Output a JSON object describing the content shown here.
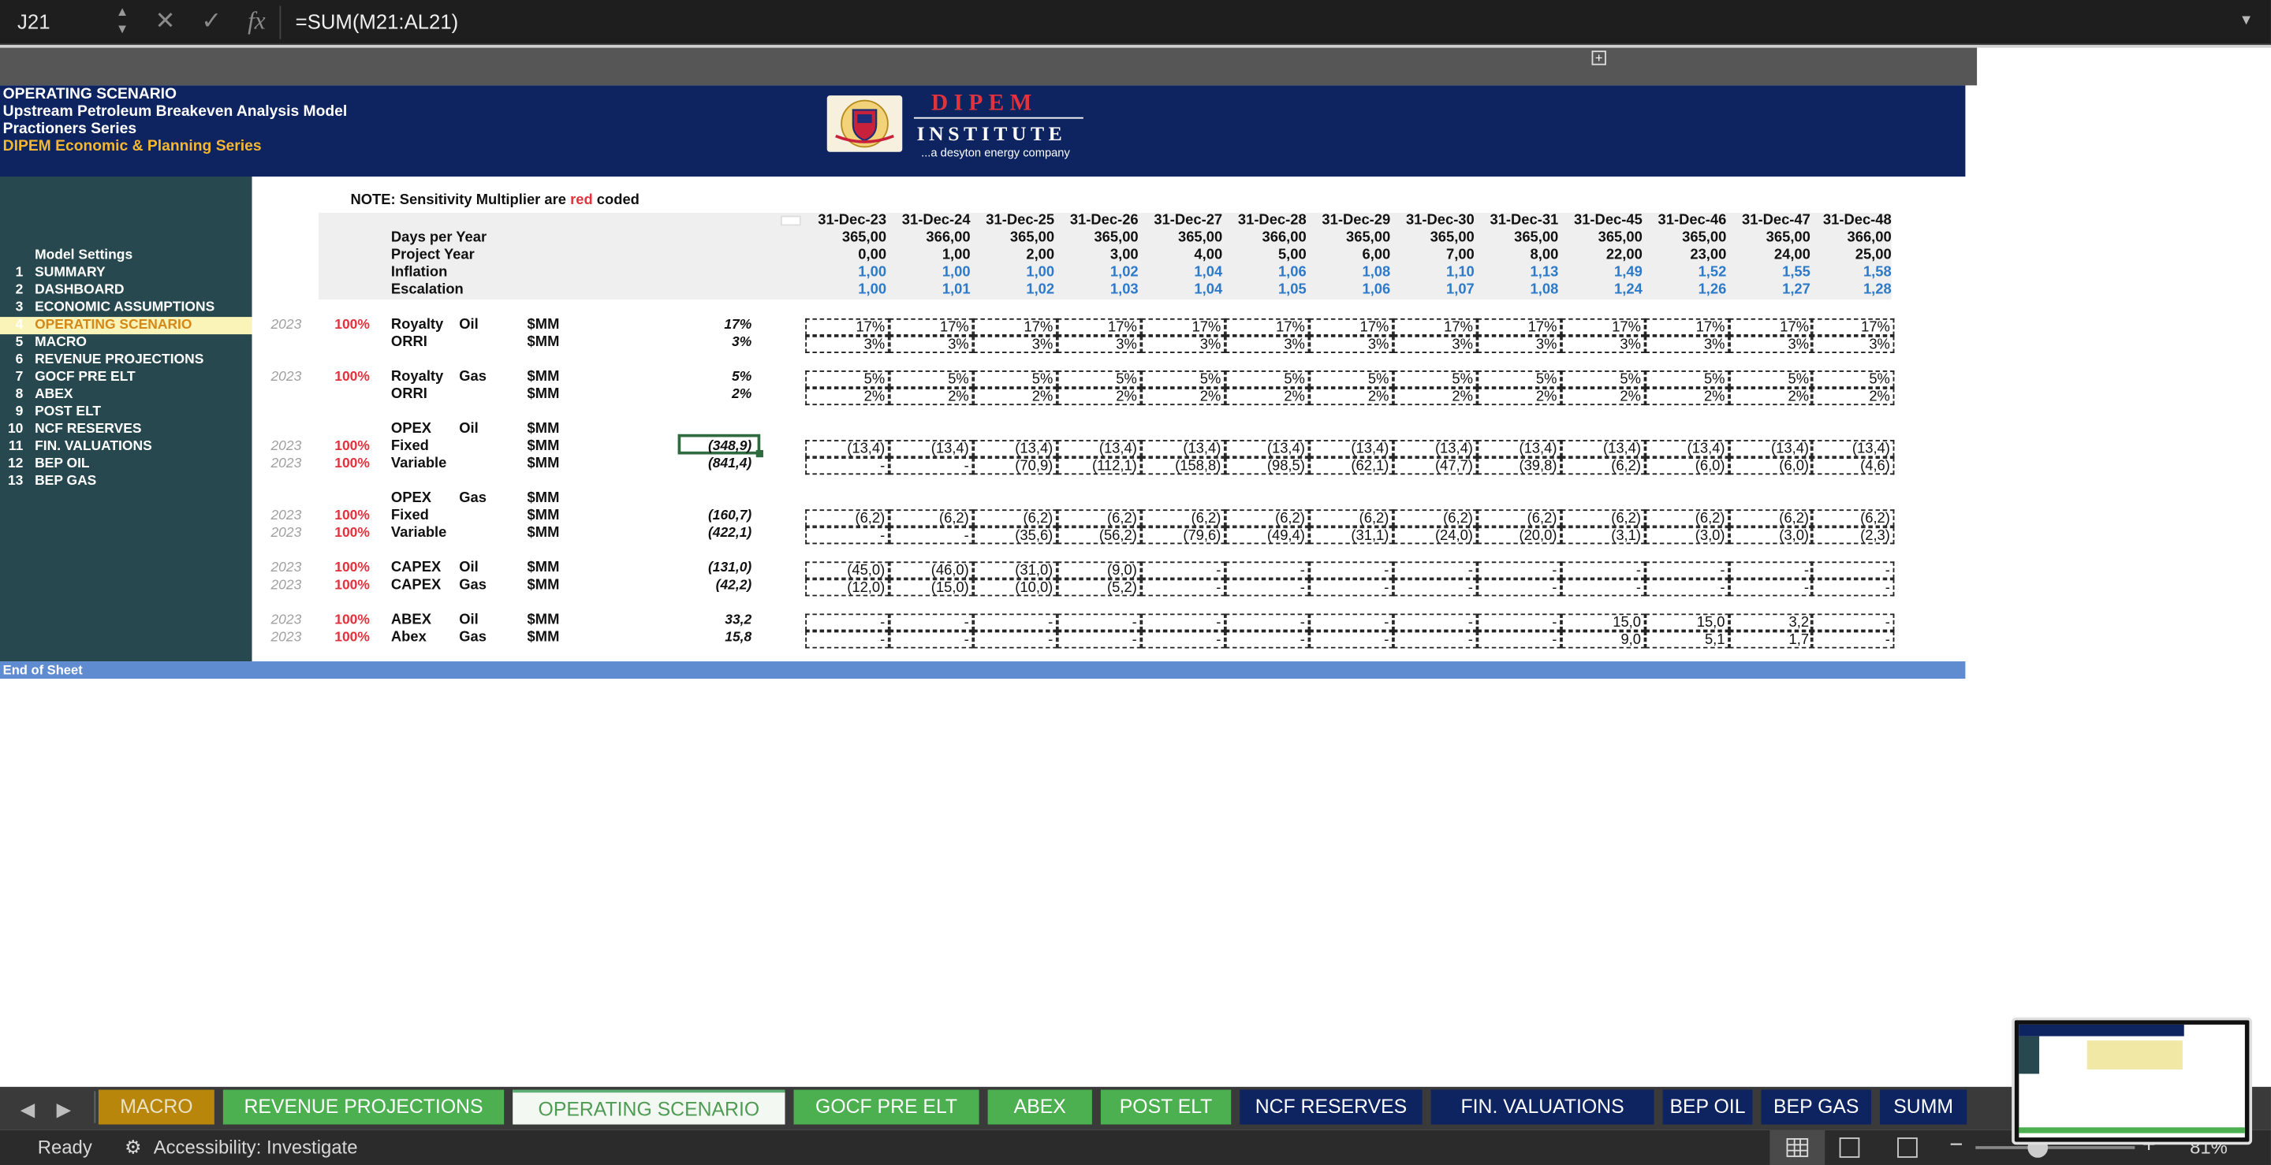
{
  "formula_bar": {
    "name_box": "J21",
    "fx": "fx",
    "formula": "=SUM(M21:AL21)"
  },
  "header": {
    "lines": [
      "OPERATING SCENARIO",
      "Upstream Petroleum Breakeven Analysis Model",
      "Practioners Series",
      "DIPEM Economic & Planning Series"
    ],
    "line_colors": [
      "#ffffff",
      "#ffffff",
      "#ffffff",
      "#f5b731"
    ],
    "brand_name": "DIPEM",
    "brand_sub": "INSTITUTE",
    "brand_tagline": "...a desyton energy company"
  },
  "sidebar": {
    "title": "Model  Settings",
    "items": [
      {
        "num": "1",
        "label": "SUMMARY"
      },
      {
        "num": "2",
        "label": "DASHBOARD"
      },
      {
        "num": "3",
        "label": "ECONOMIC ASSUMPTIONS"
      },
      {
        "num": "4",
        "label": "OPERATING SCENARIO"
      },
      {
        "num": "5",
        "label": "MACRO"
      },
      {
        "num": "6",
        "label": "REVENUE PROJECTIONS"
      },
      {
        "num": "7",
        "label": "GOCF  PRE ELT"
      },
      {
        "num": "8",
        "label": "ABEX"
      },
      {
        "num": "9",
        "label": "POST ELT"
      },
      {
        "num": "10",
        "label": "NCF RESERVES"
      },
      {
        "num": "11",
        "label": "FIN. VALUATIONS"
      },
      {
        "num": "12",
        "label": "BEP OIL"
      },
      {
        "num": "13",
        "label": "BEP GAS"
      }
    ],
    "active_index": 3
  },
  "note": {
    "prefix": "NOTE: Sensitivity Multiplier are ",
    "red_word": "red",
    "suffix": " coded"
  },
  "dates": [
    "31-Dec-23",
    "31-Dec-24",
    "31-Dec-25",
    "31-Dec-26",
    "31-Dec-27",
    "31-Dec-28",
    "31-Dec-29",
    "31-Dec-30",
    "31-Dec-31",
    "31-Dec-45",
    "31-Dec-46",
    "31-Dec-47",
    "31-Dec-48"
  ],
  "header_rows": [
    {
      "label": "Days per Year",
      "blue": false,
      "values": [
        "365,00",
        "366,00",
        "365,00",
        "365,00",
        "365,00",
        "366,00",
        "365,00",
        "365,00",
        "365,00",
        "365,00",
        "365,00",
        "365,00",
        "366,00"
      ]
    },
    {
      "label": "Project Year",
      "blue": false,
      "values": [
        "0,00",
        "1,00",
        "2,00",
        "3,00",
        "4,00",
        "5,00",
        "6,00",
        "7,00",
        "8,00",
        "22,00",
        "23,00",
        "24,00",
        "25,00"
      ]
    },
    {
      "label": "Inflation",
      "blue": true,
      "values": [
        "1,00",
        "1,00",
        "1,00",
        "1,02",
        "1,04",
        "1,06",
        "1,08",
        "1,10",
        "1,13",
        "1,49",
        "1,52",
        "1,55",
        "1,58"
      ]
    },
    {
      "label": "Escalation",
      "blue": true,
      "values": [
        "1,00",
        "1,01",
        "1,02",
        "1,03",
        "1,04",
        "1,05",
        "1,06",
        "1,07",
        "1,08",
        "1,24",
        "1,26",
        "1,27",
        "1,28"
      ]
    }
  ],
  "rows": [
    {
      "year": "2023",
      "pct": "100%",
      "c1": "Royalty",
      "c2": "Oil",
      "unit": "$MM",
      "mult": "17%",
      "values": [
        "17%",
        "17%",
        "17%",
        "17%",
        "17%",
        "17%",
        "17%",
        "17%",
        "17%",
        "17%",
        "17%",
        "17%",
        "17%"
      ]
    },
    {
      "year": "",
      "pct": "",
      "c1": "ORRI",
      "c2": "",
      "unit": "$MM",
      "mult": "3%",
      "values": [
        "3%",
        "3%",
        "3%",
        "3%",
        "3%",
        "3%",
        "3%",
        "3%",
        "3%",
        "3%",
        "3%",
        "3%",
        "3%"
      ]
    },
    {
      "year": "2023",
      "pct": "100%",
      "c1": "Royalty",
      "c2": "Gas",
      "unit": "$MM",
      "mult": "5%",
      "values": [
        "5%",
        "5%",
        "5%",
        "5%",
        "5%",
        "5%",
        "5%",
        "5%",
        "5%",
        "5%",
        "5%",
        "5%",
        "5%"
      ]
    },
    {
      "year": "",
      "pct": "",
      "c1": "ORRI",
      "c2": "",
      "unit": "$MM",
      "mult": "2%",
      "values": [
        "2%",
        "2%",
        "2%",
        "2%",
        "2%",
        "2%",
        "2%",
        "2%",
        "2%",
        "2%",
        "2%",
        "2%",
        "2%"
      ]
    },
    {
      "year": "",
      "pct": "",
      "c1": "OPEX",
      "c2": "Oil",
      "unit": "$MM",
      "mult": "",
      "values": null
    },
    {
      "year": "2023",
      "pct": "100%",
      "c1": "Fixed",
      "c2": "",
      "unit": "$MM",
      "mult": "(348,9)",
      "values": [
        "(13,4)",
        "(13,4)",
        "(13,4)",
        "(13,4)",
        "(13,4)",
        "(13,4)",
        "(13,4)",
        "(13,4)",
        "(13,4)",
        "(13,4)",
        "(13,4)",
        "(13,4)",
        "(13,4)"
      ]
    },
    {
      "year": "2023",
      "pct": "100%",
      "c1": "Variable",
      "c2": "",
      "unit": "$MM",
      "mult": "(841,4)",
      "values": [
        "-",
        "-",
        "(70,9)",
        "(112,1)",
        "(158,8)",
        "(98,5)",
        "(62,1)",
        "(47,7)",
        "(39,8)",
        "(6,2)",
        "(6,0)",
        "(6,0)",
        "(4,6)"
      ]
    },
    {
      "year": "",
      "pct": "",
      "c1": "OPEX",
      "c2": "Gas",
      "unit": "$MM",
      "mult": "",
      "values": null
    },
    {
      "year": "2023",
      "pct": "100%",
      "c1": "Fixed",
      "c2": "",
      "unit": "$MM",
      "mult": "(160,7)",
      "values": [
        "(6,2)",
        "(6,2)",
        "(6,2)",
        "(6,2)",
        "(6,2)",
        "(6,2)",
        "(6,2)",
        "(6,2)",
        "(6,2)",
        "(6,2)",
        "(6,2)",
        "(6,2)",
        "(6,2)"
      ]
    },
    {
      "year": "2023",
      "pct": "100%",
      "c1": "Variable",
      "c2": "",
      "unit": "$MM",
      "mult": "(422,1)",
      "values": [
        "-",
        "-",
        "(35,6)",
        "(56,2)",
        "(79,6)",
        "(49,4)",
        "(31,1)",
        "(24,0)",
        "(20,0)",
        "(3,1)",
        "(3,0)",
        "(3,0)",
        "(2,3)"
      ]
    },
    {
      "year": "2023",
      "pct": "100%",
      "c1": "CAPEX",
      "c2": "Oil",
      "unit": "$MM",
      "mult": "(131,0)",
      "values": [
        "(45,0)",
        "(46,0)",
        "(31,0)",
        "(9,0)",
        "-",
        "-",
        "-",
        "-",
        "-",
        "-",
        "-",
        "-",
        "-"
      ]
    },
    {
      "year": "2023",
      "pct": "100%",
      "c1": "CAPEX",
      "c2": "Gas",
      "unit": "$MM",
      "mult": "(42,2)",
      "values": [
        "(12,0)",
        "(15,0)",
        "(10,0)",
        "(5,2)",
        "-",
        "-",
        "-",
        "-",
        "-",
        "-",
        "-",
        "-",
        "-"
      ]
    },
    {
      "year": "2023",
      "pct": "100%",
      "c1": "ABEX",
      "c2": "Oil",
      "unit": "$MM",
      "mult": "33,2",
      "values": [
        "-",
        "-",
        "-",
        "-",
        "-",
        "-",
        "-",
        "-",
        "-",
        "15,0",
        "15,0",
        "3,2",
        "-"
      ]
    },
    {
      "year": "2023",
      "pct": "100%",
      "c1": "Abex",
      "c2": "Gas",
      "unit": "$MM",
      "mult": "15,8",
      "values": [
        "-",
        "-",
        "-",
        "-",
        "-",
        "-",
        "-",
        "-",
        "-",
        "9,0",
        "5,1",
        "1,7",
        "-"
      ]
    }
  ],
  "end_of_sheet": "End of Sheet",
  "tabs": [
    {
      "label": "MACRO",
      "bg": "#b8860b",
      "fg": "#e9e1c4"
    },
    {
      "label": "REVENUE PROJECTIONS",
      "bg": "#4caf50",
      "fg": "#ffffff"
    },
    {
      "label": "OPERATING SCENARIO",
      "bg": "#f4f8f2",
      "fg": "#4e9b54",
      "active": true
    },
    {
      "label": "GOCF  PRE ELT",
      "bg": "#4caf50",
      "fg": "#ffffff"
    },
    {
      "label": "ABEX",
      "bg": "#4caf50",
      "fg": "#ffffff"
    },
    {
      "label": "POST ELT",
      "bg": "#4caf50",
      "fg": "#ffffff"
    },
    {
      "label": "NCF RESERVES",
      "bg": "#0d2461",
      "fg": "#ffffff"
    },
    {
      "label": "FIN. VALUATIONS",
      "bg": "#0d2461",
      "fg": "#ffffff"
    },
    {
      "label": "BEP OIL",
      "bg": "#0d2461",
      "fg": "#ffffff"
    },
    {
      "label": "BEP GAS",
      "bg": "#0d2461",
      "fg": "#ffffff"
    },
    {
      "label": "SUMM",
      "bg": "#0d2461",
      "fg": "#ffffff"
    }
  ],
  "status": {
    "ready": "Ready",
    "accessibility": "Accessibility: Investigate",
    "zoom": "81%"
  }
}
